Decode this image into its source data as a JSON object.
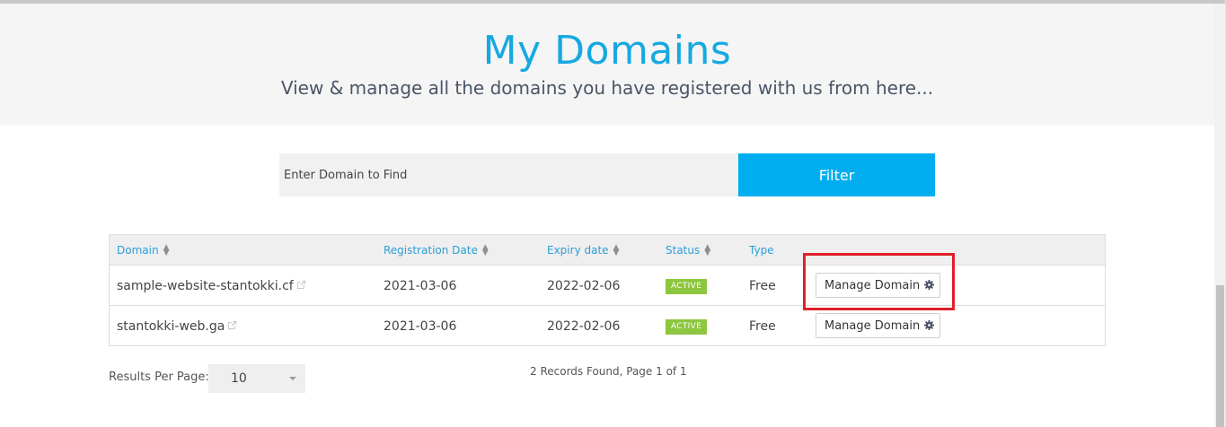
{
  "header": {
    "title": "My Domains",
    "subtitle": "View & manage all the domains you have registered with us from here..."
  },
  "search": {
    "placeholder": "Enter Domain to Find",
    "filter_label": "Filter"
  },
  "table": {
    "columns": [
      "Domain",
      "Registration Date",
      "Expiry date",
      "Status",
      "Type"
    ],
    "rows": [
      {
        "domain": "sample-website-stantokki.cf",
        "registration_date": "2021-03-06",
        "expiry_date": "2022-02-06",
        "status": "ACTIVE",
        "type": "Free",
        "action": "Manage Domain"
      },
      {
        "domain": "stantokki-web.ga",
        "registration_date": "2021-03-06",
        "expiry_date": "2022-02-06",
        "status": "ACTIVE",
        "type": "Free",
        "action": "Manage Domain"
      }
    ]
  },
  "pagination": {
    "results_per_page_label": "Results Per Page:",
    "results_per_page_value": "10",
    "records_text": "2 Records Found, Page 1 of 1"
  },
  "colors": {
    "accent": "#00aeef",
    "title": "#16a9e1",
    "status_active": "#8dc63f",
    "highlight": "#e0202a"
  },
  "icons": {
    "sort": "sort-icon",
    "external_link": "external-link-icon",
    "manage": "gear-icon",
    "select": "chevron-down-icon"
  }
}
